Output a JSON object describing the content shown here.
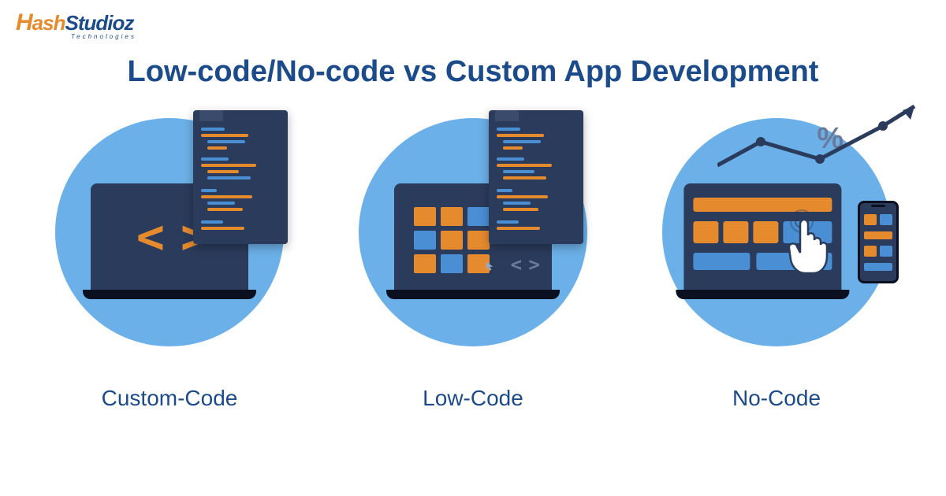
{
  "logo": {
    "part1": "H",
    "part2": "ash",
    "part3": "Studioz",
    "subtitle": "Technologies"
  },
  "title": "Low-code/No-code vs Custom App Development",
  "cards": [
    {
      "label": "Custom-Code",
      "icon": "custom-code-icon"
    },
    {
      "label": "Low-Code",
      "icon": "low-code-icon"
    },
    {
      "label": "No-Code",
      "icon": "no-code-icon"
    }
  ],
  "symbols": {
    "percent": "%",
    "brackets": "< >"
  },
  "colors": {
    "brand_blue": "#1b4b8a",
    "brand_orange": "#e68a2e",
    "circle_bg": "#6bb0e8",
    "screen_bg": "#2a3b5c",
    "accent_blue": "#4a8fd4"
  }
}
